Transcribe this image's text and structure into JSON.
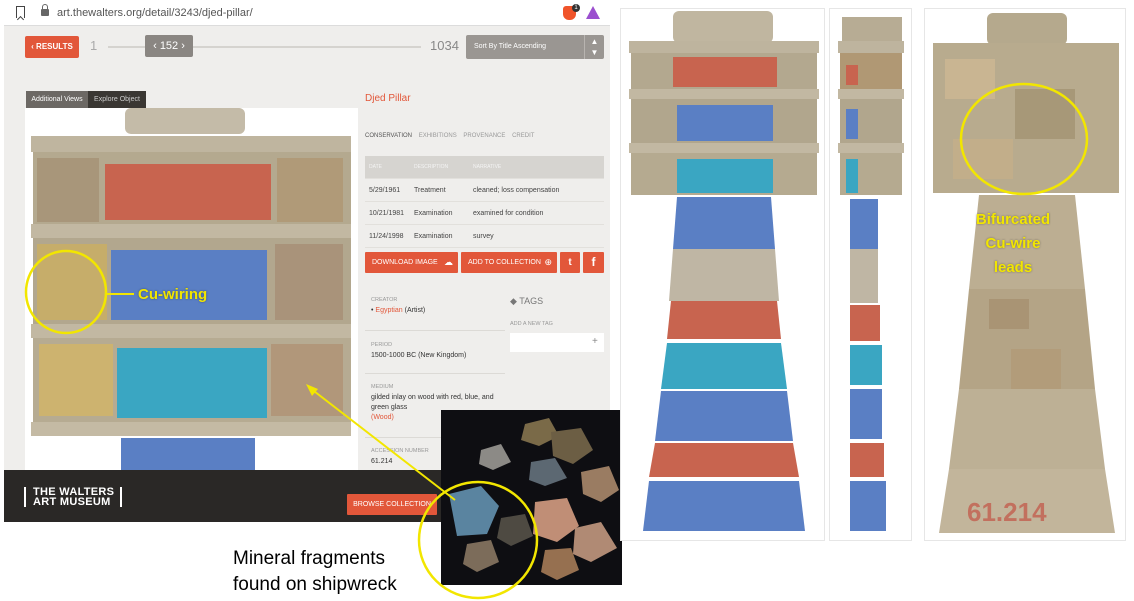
{
  "browser": {
    "url": "art.thewalters.org/detail/3243/djed-pillar/",
    "brave_badge": "1"
  },
  "nav": {
    "results_label": "‹ RESULTS",
    "pager_start": "1",
    "pager_current": "‹ 152 ›",
    "pager_end": "1034",
    "sort_label": "Sort By Title Ascending",
    "sort_chevron": "⌃⌄"
  },
  "viewer": {
    "tab_additional": "Additional Views",
    "tab_explore": "Explore Object"
  },
  "object": {
    "title": "Djed Pillar",
    "tabs": [
      "CONSERVATION",
      "EXHIBITIONS",
      "PROVENANCE",
      "CREDIT"
    ],
    "conservation_headers": [
      "DATE",
      "DESCRIPTION",
      "NARRATIVE"
    ],
    "conservation_rows": [
      {
        "date": "5/29/1961",
        "description": "Treatment",
        "narrative": "cleaned; loss compensation"
      },
      {
        "date": "10/21/1981",
        "description": "Examination",
        "narrative": "examined for condition"
      },
      {
        "date": "11/24/1998",
        "description": "Examination",
        "narrative": "survey"
      }
    ],
    "download_label": "DOWNLOAD IMAGE",
    "collection_label": "ADD TO COLLECTION",
    "twitter_glyph": "t",
    "facebook_glyph": "f",
    "creator_label": "CREATOR",
    "creator_bullet": "•",
    "creator_link": "Egyptian",
    "creator_role": "(Artist)",
    "period_label": "PERIOD",
    "period_value": "1500-1000 BC (New Kingdom)",
    "medium_label": "MEDIUM",
    "medium_value": "gilded inlay on wood with red, blue, and green glass",
    "medium_link": "(Wood)",
    "accession_label": "ACCESSION NUMBER",
    "accession_value": "61.214",
    "tags_title": "TAGS",
    "add_tag_label": "ADD A NEW TAG",
    "add_tag_plus": "+"
  },
  "footer": {
    "logo_line1": "THE WALTERS",
    "logo_line2": "ART MUSEUM",
    "browse_label": "BROWSE COLLECTION"
  },
  "annotations": {
    "cu_wiring": "Cu-wiring",
    "bifurcated_1": "Bifurcated",
    "bifurcated_2": "Cu-wire",
    "bifurcated_3": "leads",
    "caption_line1": "Mineral fragments",
    "caption_line2": "found on shipwreck",
    "accession_painted": "61.214"
  },
  "colors": {
    "accent": "#e2573a",
    "annotation": "#f2e600",
    "red_glass": "#c8644f",
    "blue_glass": "#5a7fc4",
    "green_glass": "#3aa6c2",
    "wood": "#b7ad97"
  }
}
